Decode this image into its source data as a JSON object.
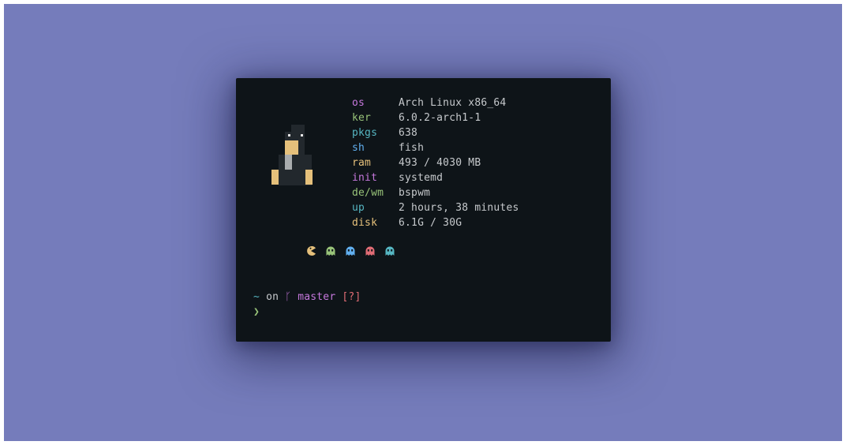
{
  "colors": {
    "background": "#757cbb",
    "terminal_bg": "#0e1418",
    "value_text": "#c6c9cc",
    "purple": "#c678dd",
    "green": "#98c379",
    "cyan": "#56b6c2",
    "blue": "#61afef",
    "yellow": "#e5c07b",
    "red": "#e06c75"
  },
  "fetch": [
    {
      "key": "os",
      "value": "Arch Linux x86_64",
      "color": "#c678dd"
    },
    {
      "key": "ker",
      "value": "6.0.2-arch1-1",
      "color": "#98c379"
    },
    {
      "key": "pkgs",
      "value": "638",
      "color": "#56b6c2"
    },
    {
      "key": "sh",
      "value": "fish",
      "color": "#61afef"
    },
    {
      "key": "ram",
      "value": "493 / 4030 MB",
      "color": "#e5c07b"
    },
    {
      "key": "init",
      "value": "systemd",
      "color": "#c678dd"
    },
    {
      "key": "de/wm",
      "value": "bspwm",
      "color": "#98c379"
    },
    {
      "key": "up",
      "value": "2 hours, 38 minutes",
      "color": "#56b6c2"
    },
    {
      "key": "disk",
      "value": "6.1G / 30G",
      "color": "#e5c07b"
    }
  ],
  "icons": [
    {
      "name": "pacman-icon",
      "color": "#e5c07b"
    },
    {
      "name": "ghost-green-icon",
      "color": "#98c379"
    },
    {
      "name": "ghost-blue-icon",
      "color": "#61afef"
    },
    {
      "name": "ghost-red-icon",
      "color": "#e06c75"
    },
    {
      "name": "ghost-cyan-icon",
      "color": "#56b6c2"
    }
  ],
  "prompt": {
    "tilde": "~",
    "on": "on",
    "branch_icon": "ᚴ",
    "branch": "master",
    "status": "[?]",
    "caret": "❯"
  }
}
